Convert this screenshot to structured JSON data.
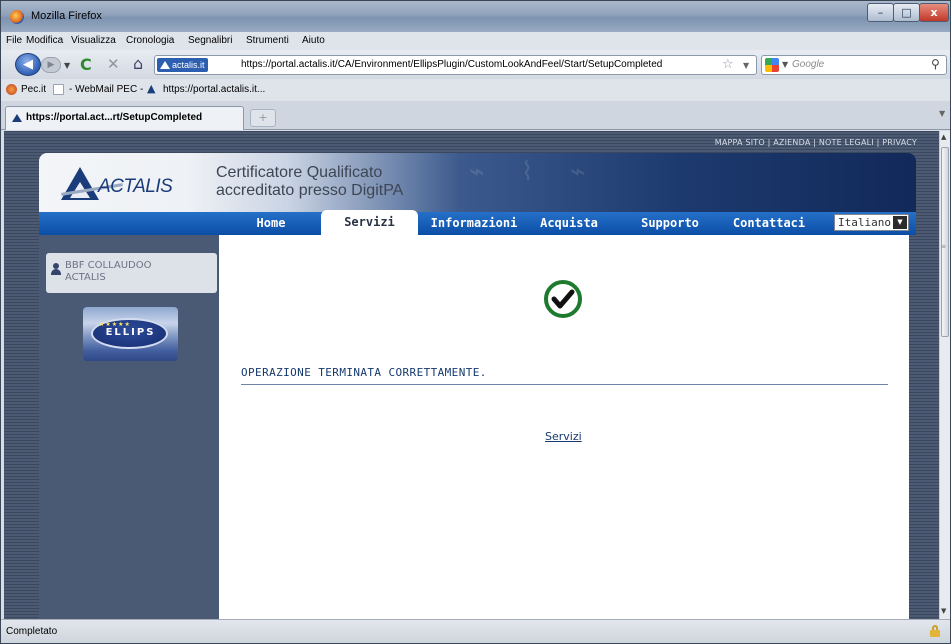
{
  "window": {
    "title": "Mozilla Firefox",
    "controls": {
      "minimize": "–",
      "maximize": "□",
      "close": "x"
    }
  },
  "menu": [
    "File",
    "Modifica",
    "Visualizza",
    "Cronologia",
    "Segnalibri",
    "Strumenti",
    "Aiuto"
  ],
  "nav": {
    "url_site_identity": "actalis.it",
    "url": "https://portal.actalis.it/CA/Environment/EllipsPlugin/CustomLookAndFeel/Start/SetupCompleted",
    "search_placeholder": "Google"
  },
  "bookmarks": [
    "Pec.it",
    "- WebMail PEC -",
    "https://portal.actalis.it..."
  ],
  "tab": {
    "label": "https://portal.act...rt/SetupCompleted",
    "new_tab_symbol": "+"
  },
  "page": {
    "top_links": "MAPPA SITO | AZIENDA | NOTE LEGALI | PRIVACY",
    "logo_text": "ACTALIS",
    "tagline": [
      "Certificatore Qualificato",
      "accreditato presso DigitPA"
    ],
    "nav_items": [
      "Home",
      "Servizi",
      "Informazioni",
      "Acquista",
      "Supporto",
      "Contattaci"
    ],
    "active_nav": "Servizi",
    "language": "Italiano",
    "user": [
      "BBF COLLAUDOO",
      "ACTALIS"
    ],
    "ellips_logo_text": "ELLIPS",
    "message": "OPERAZIONE TERMINATA CORRETTAMENTE.",
    "link_servizi": "Servizi"
  },
  "status": {
    "text": "Completato"
  },
  "colors": {
    "nav_blue": "#0c4ea6",
    "page_bg": "#4c5b73",
    "success_green": "#1d7a2e",
    "message_text": "#153a6e"
  }
}
